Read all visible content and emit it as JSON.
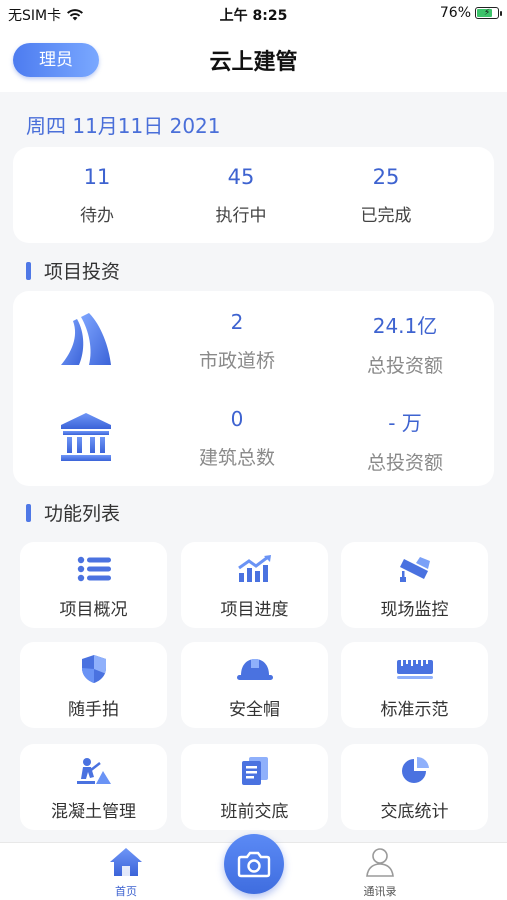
{
  "status_bar": {
    "carrier": "无SIM卡",
    "time": "上午 8:25",
    "battery": "76%"
  },
  "header": {
    "role_label": "理员",
    "title": "云上建管"
  },
  "date": "周四 11月11日 2021",
  "stats": [
    {
      "value": "11",
      "label": "待办"
    },
    {
      "value": "45",
      "label": "执行中"
    },
    {
      "value": "25",
      "label": "已完成"
    }
  ],
  "investment": {
    "section_title": "项目投资",
    "rows": [
      {
        "icon": "road-icon",
        "count": "2",
        "count_label": "市政道桥",
        "amount": "24.1亿",
        "amount_label": "总投资额"
      },
      {
        "icon": "building-icon",
        "count": "0",
        "count_label": "建筑总数",
        "amount": "- 万",
        "amount_label": "总投资额"
      }
    ]
  },
  "functions": {
    "section_title": "功能列表",
    "items": [
      {
        "label": "项目概况",
        "icon": "list-icon"
      },
      {
        "label": "项目进度",
        "icon": "chart-growth-icon"
      },
      {
        "label": "现场监控",
        "icon": "cctv-camera-icon"
      },
      {
        "label": "随手拍",
        "icon": "shield-icon"
      },
      {
        "label": "安全帽",
        "icon": "helmet-icon"
      },
      {
        "label": "标准示范",
        "icon": "ruler-icon"
      },
      {
        "label": "混凝土管理",
        "icon": "worker-icon"
      },
      {
        "label": "班前交底",
        "icon": "documents-icon"
      },
      {
        "label": "交底统计",
        "icon": "pie-chart-icon"
      }
    ]
  },
  "tabbar": {
    "home_label": "首页",
    "contacts_label": "通讯录",
    "active_color": "#3e63d0"
  }
}
